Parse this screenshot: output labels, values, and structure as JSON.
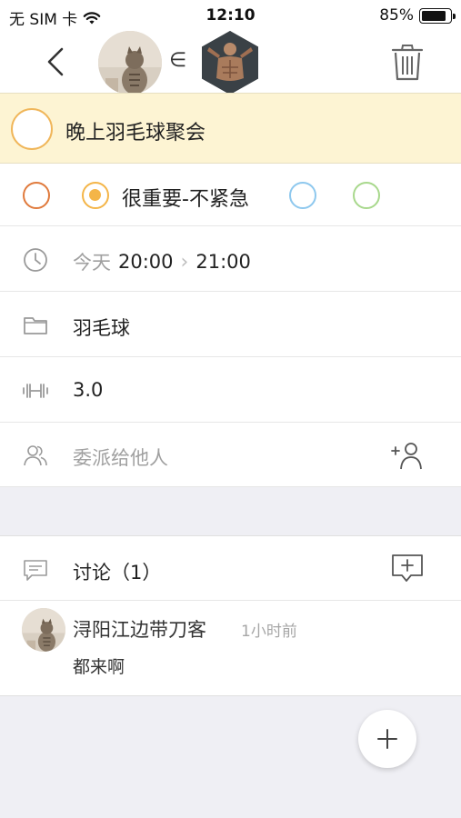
{
  "status_bar": {
    "carrier": "无 SIM 卡",
    "time": "12:10",
    "battery": "85%",
    "battery_level": 0.85
  },
  "nav": {
    "back_icon": "chevron-left-icon",
    "belongs_symbol": "∈",
    "trash_icon": "trash-icon"
  },
  "task": {
    "title": "晚上羽毛球聚会"
  },
  "priority": {
    "selected_label": "很重要-不紧急",
    "colors": {
      "red": "#e07a3c",
      "yellow": "#f4b548",
      "blue": "#8ec8ee",
      "green": "#a8d88c"
    }
  },
  "time": {
    "day": "今天",
    "start": "20:00",
    "end": "21:00"
  },
  "category": "羽毛球",
  "weight": "3.0",
  "delegate_placeholder": "委派给他人",
  "discussion": {
    "label": "讨论（1）"
  },
  "comment": {
    "author": "浔阳江边带刀客",
    "time": "1小时前",
    "text": "都来啊"
  },
  "colors": {
    "title_bg": "#fdf4d3",
    "gray_bg": "#efeff4"
  }
}
